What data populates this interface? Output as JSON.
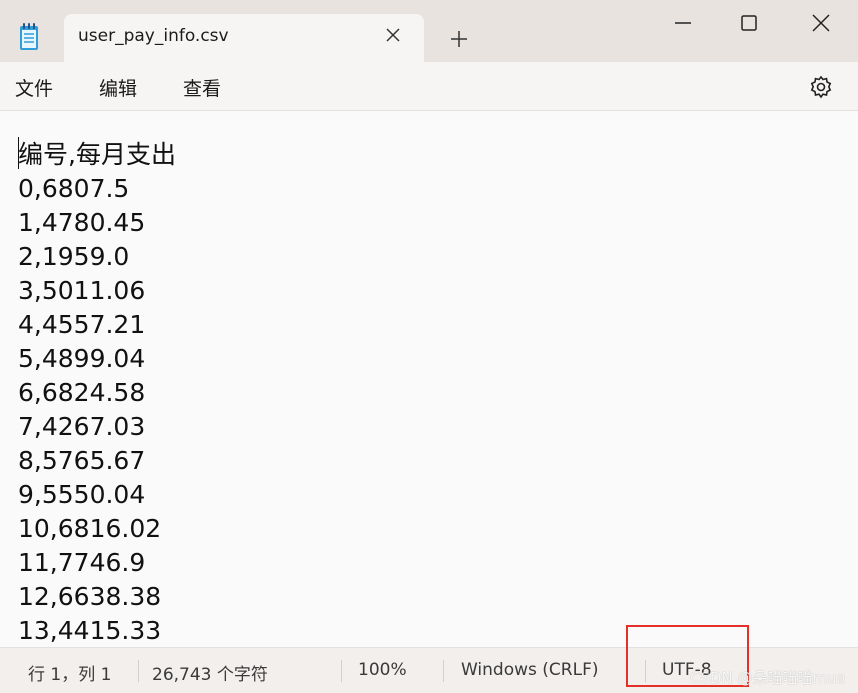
{
  "window": {
    "tab_title": "user_pay_info.csv",
    "icons": [
      "notepad-icon",
      "close-icon",
      "plus-icon",
      "minimize-icon",
      "maximize-icon",
      "window-close-icon",
      "gear-icon"
    ]
  },
  "menu": {
    "file": "文件",
    "edit": "编辑",
    "view": "查看"
  },
  "editor": {
    "lines": [
      "编号,每月支出",
      "0,6807.5",
      "1,4780.45",
      "2,1959.0",
      "3,5011.06",
      "4,4557.21",
      "5,4899.04",
      "6,6824.58",
      "7,4267.03",
      "8,5765.67",
      "9,5550.04",
      "10,6816.02",
      "11,7746.9",
      "12,6638.38",
      "13,4415.33"
    ]
  },
  "status": {
    "position": "行 1，列 1",
    "char_count": "26,743 个字符",
    "zoom": "100%",
    "line_ending": "Windows (CRLF)",
    "encoding": "UTF-8"
  },
  "watermark": "CSDN @朵喵喵喵mua",
  "colors": {
    "highlight": "#e5302a"
  }
}
